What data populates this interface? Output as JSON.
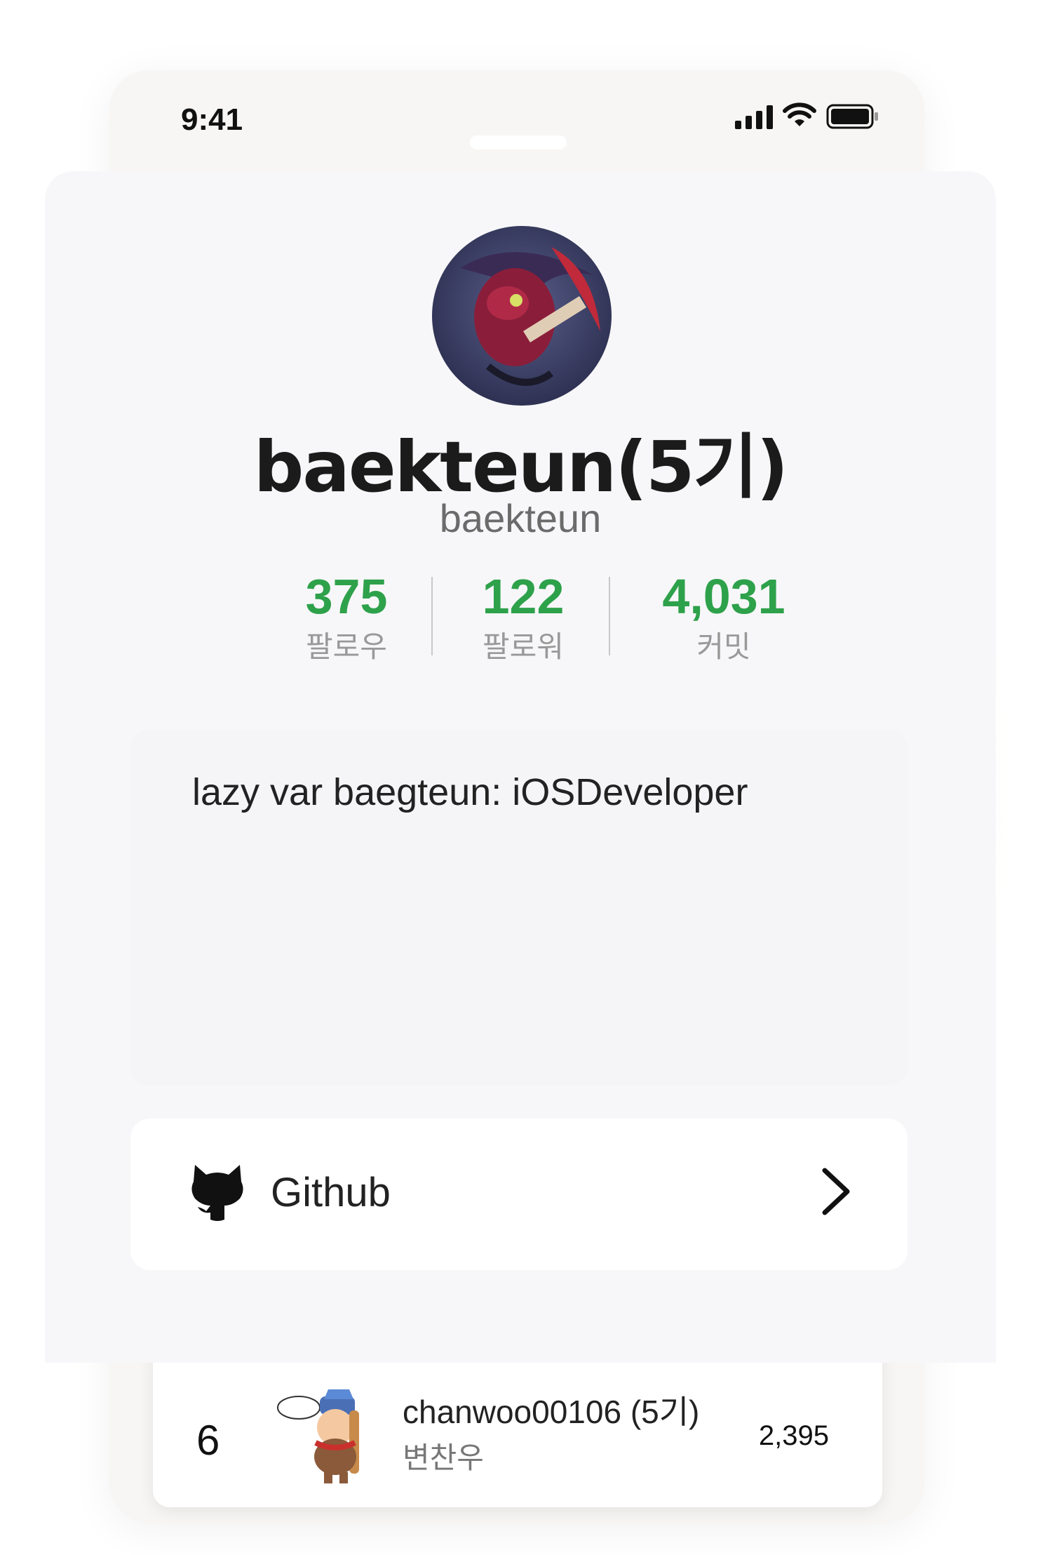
{
  "status_bar": {
    "time": "9:41",
    "icons": [
      "cellular-signal-icon",
      "wifi-icon",
      "battery-icon"
    ]
  },
  "profile": {
    "avatar_icon": "profile-avatar-image",
    "display_name": "baekteun(5기)",
    "username": "baekteun",
    "stats": [
      {
        "value": "375",
        "label": "팔로우"
      },
      {
        "value": "122",
        "label": "팔로워"
      },
      {
        "value": "4,031",
        "label": "커밋"
      }
    ],
    "bio": "lazy var baegteun: iOSDeveloper",
    "link": {
      "icon": "github-icon",
      "label": "Github",
      "chevron": "chevron-right-icon"
    }
  },
  "ranking_row": {
    "rank": "6",
    "handle": "chanwoo00106 (5기)",
    "name": "변찬우",
    "score": "2,395",
    "avatar_icon": "ranking-avatar-image"
  },
  "colors": {
    "accent_green": "#2ea14b",
    "sheet_background": "#f7f7f9",
    "card_white": "#ffffff"
  }
}
